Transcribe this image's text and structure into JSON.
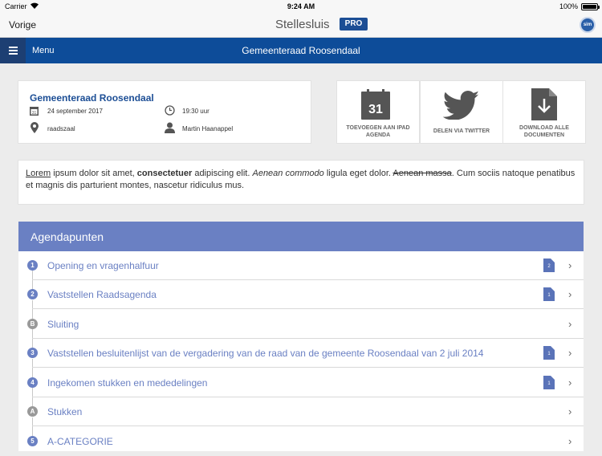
{
  "status": {
    "carrier": "Carrier",
    "time": "9:24 AM",
    "battery": "100%"
  },
  "nav": {
    "back": "Vorige",
    "title": "Stellesluis",
    "badge": "PRO",
    "logo": "sim"
  },
  "header": {
    "menu": "Menu",
    "title": "Gemeenteraad Roosendaal"
  },
  "meeting": {
    "title": "Gemeenteraad Roosendaal",
    "date": "24 september 2017",
    "time": "19:30 uur",
    "location": "raadszaal",
    "person": "Martin Haanappel",
    "calendar_day": "31"
  },
  "actions": [
    {
      "label": "TOEVOEGEN AAN IPAD AGENDA",
      "icon": "calendar-icon"
    },
    {
      "label": "DELEN VIA TWITTER",
      "icon": "twitter-icon"
    },
    {
      "label": "DOWNLOAD ALLE DOCUMENTEN",
      "icon": "download-document-icon"
    }
  ],
  "description": {
    "w1": "Lorem",
    "w2": " ipsum dolor sit amet, ",
    "w3": "consectetuer",
    "w4": " adipiscing elit. ",
    "w5": "Aenean commodo",
    "w6": " ligula eget dolor. ",
    "w7": "Aenean massa",
    "w8": ". Cum sociis natoque penatibus et magnis dis parturient montes, nascetur ridiculus mus."
  },
  "agenda": {
    "title": "Agendapunten",
    "items": [
      {
        "num": "1",
        "label": "Opening en vragenhalfuur",
        "docs": "2"
      },
      {
        "num": "2",
        "label": "Vaststellen Raadsagenda",
        "docs": "1"
      },
      {
        "num": "B",
        "label": "Sluiting",
        "docs": ""
      },
      {
        "num": "3",
        "label": "Vaststellen besluitenlijst van de vergadering van de raad van de gemeente Roosendaal van 2 juli 2014",
        "docs": "1"
      },
      {
        "num": "4",
        "label": "Ingekomen stukken en mededelingen",
        "docs": "1"
      },
      {
        "num": "A",
        "label": "Stukken",
        "docs": ""
      },
      {
        "num": "5",
        "label": "A-CATEGORIE",
        "docs": ""
      }
    ]
  },
  "colors": {
    "brand_blue": "#0d4c99",
    "agenda_blue": "#6a80c3"
  }
}
